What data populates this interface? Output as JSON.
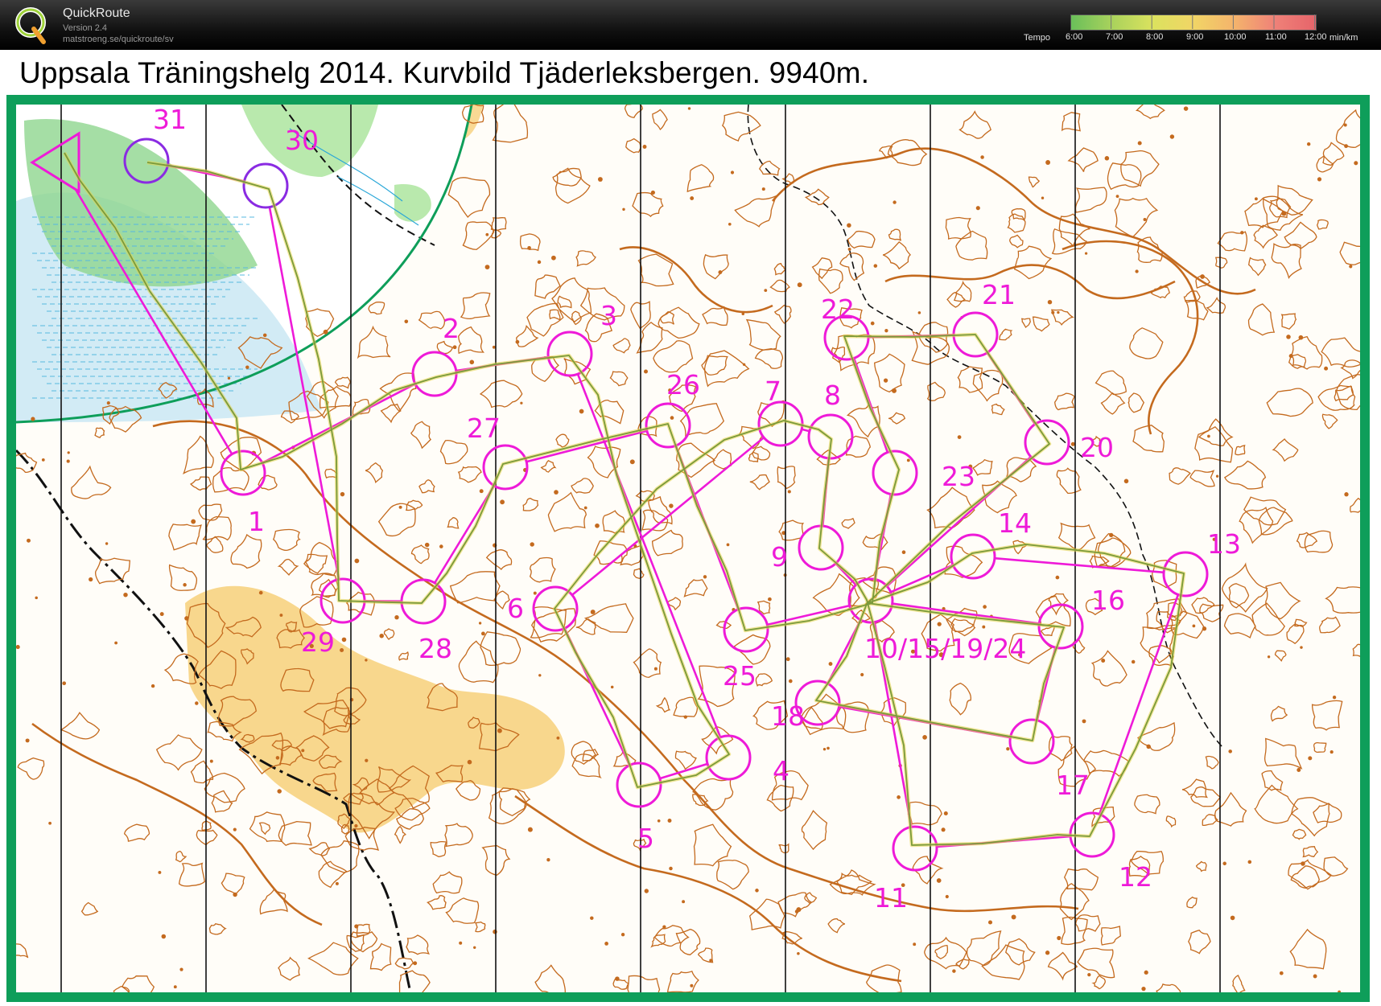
{
  "app": {
    "name": "QuickRoute",
    "version": "Version 2.4",
    "url": "matstroeng.se/quickroute/sv",
    "logo_letter": "Q"
  },
  "tempo_legend": {
    "label": "Tempo",
    "ticks": [
      "6:00",
      "7:00",
      "8:00",
      "9:00",
      "10:00",
      "11:00",
      "12:00"
    ],
    "unit": "min/km",
    "colors": [
      "#6abf5a",
      "#a9d25c",
      "#dbe25e",
      "#f1d566",
      "#f4b46c",
      "#ef8178",
      "#e6646a"
    ]
  },
  "map": {
    "title": "Uppsala Träningshelg 2014. Kurvbild Tjäderleksbergen. 9940m.",
    "course_color": "#ee1ad8",
    "route_color": "#7a9a3a",
    "contour_color": "#c46a1e",
    "frame_color": "#0e9e5a",
    "controls": [
      "1",
      "2",
      "3",
      "4",
      "5",
      "6",
      "7",
      "8",
      "9",
      "10/15/19/24",
      "11",
      "12",
      "13",
      "14",
      "16",
      "17",
      "18",
      "20",
      "21",
      "22",
      "23",
      "25",
      "26",
      "27",
      "28",
      "29",
      "30",
      "31"
    ]
  }
}
